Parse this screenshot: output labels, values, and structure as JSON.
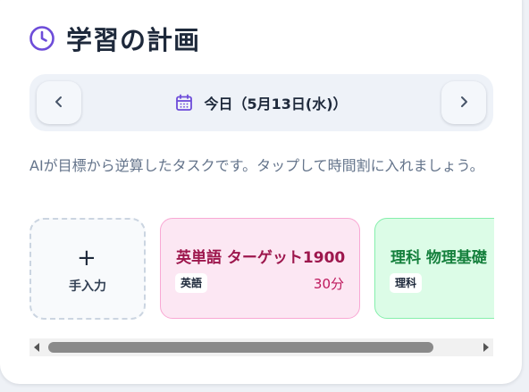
{
  "header": {
    "title": "学習の計画",
    "icon": "clock-icon",
    "accent_color": "#6d4cd9"
  },
  "date_nav": {
    "label": "今日（5月13日(水)）",
    "prev_icon": "chevron-left-icon",
    "next_icon": "chevron-right-icon",
    "calendar_icon": "calendar-icon"
  },
  "description": "AIが目標から逆算したタスクです。タップして時間割に入れましょう。",
  "manual_card": {
    "plus": "+",
    "label": "手入力"
  },
  "tasks": [
    {
      "title": "英単語 ターゲット1900",
      "tag": "英語",
      "duration": "30分",
      "color": "#fce7f3"
    },
    {
      "title": "理科 物理基礎",
      "tag": "理科",
      "color": "#dcfce7"
    }
  ]
}
